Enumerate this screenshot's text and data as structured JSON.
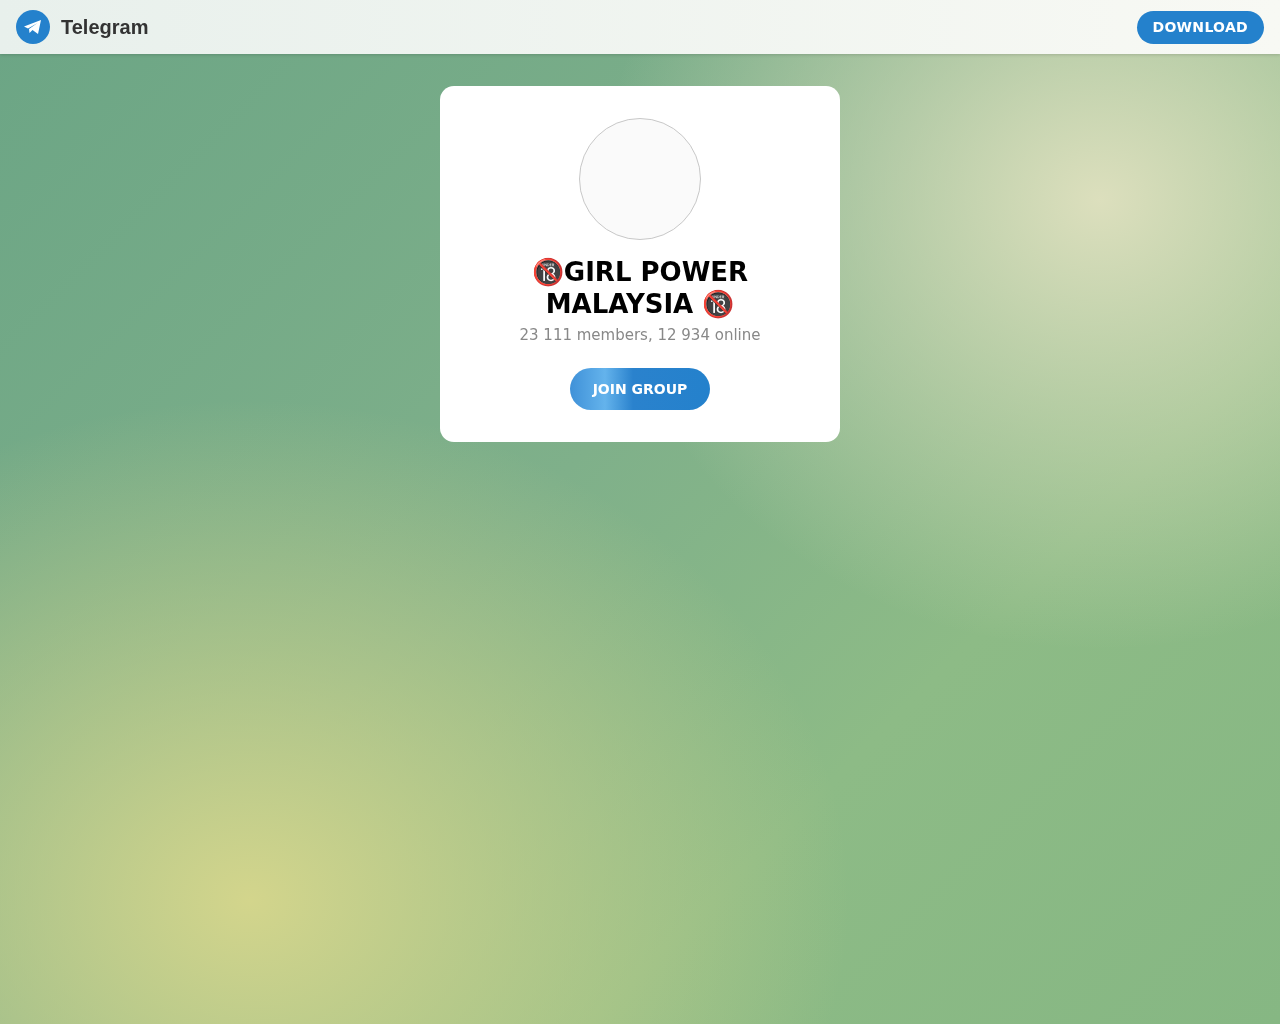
{
  "header": {
    "brand": "Telegram",
    "download_button": "DOWNLOAD"
  },
  "group": {
    "title": "🔞GIRL POWER MALAYSIA 🔞",
    "stats": "23 111 members, 12 934 online",
    "join_button": "JOIN GROUP"
  }
}
